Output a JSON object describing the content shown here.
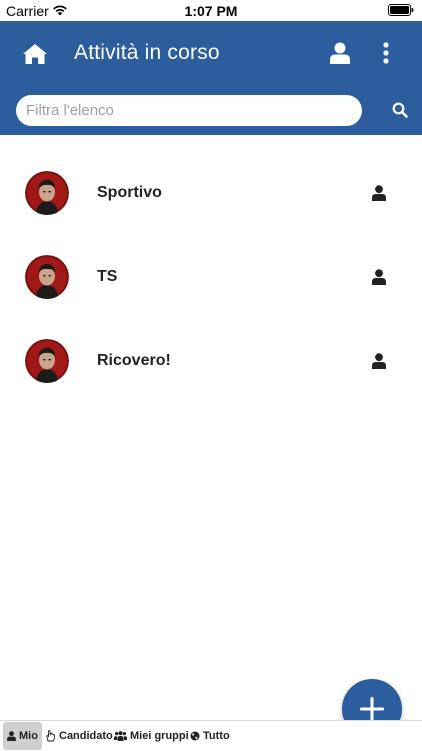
{
  "status_bar": {
    "carrier": "Carrier",
    "time": "1:07 PM"
  },
  "header": {
    "title": "Attività in corso",
    "color": "#2c5e9e"
  },
  "search": {
    "placeholder": "Filtra l'elenco",
    "value": ""
  },
  "tasks": [
    {
      "name": "Sportivo"
    },
    {
      "name": "TS"
    },
    {
      "name": "Ricovero!"
    }
  ],
  "bottom_tabs": [
    {
      "label": "Mio",
      "icon": "user-icon",
      "active": true
    },
    {
      "label": "Candidato",
      "icon": "hand-icon",
      "active": false
    },
    {
      "label": "Miei gruppi",
      "icon": "group-icon",
      "active": false
    },
    {
      "label": "Tutto",
      "icon": "globe-icon",
      "active": false
    }
  ]
}
